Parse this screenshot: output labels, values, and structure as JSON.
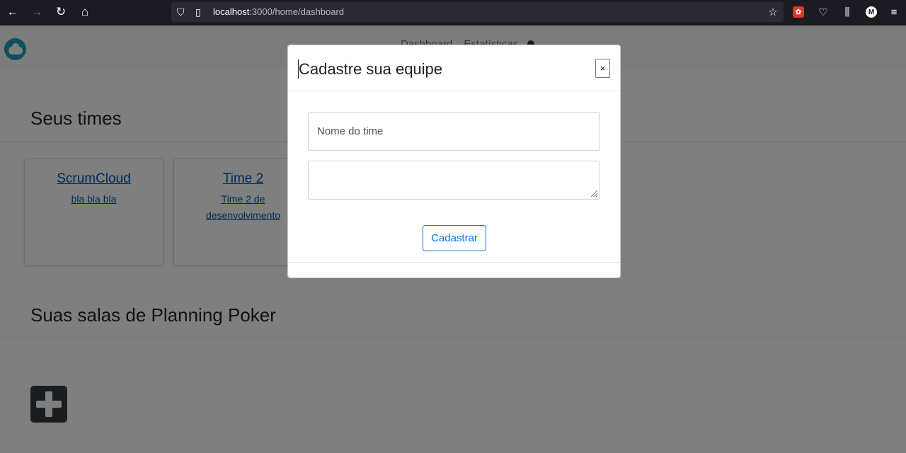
{
  "browser": {
    "url_host": "localhost",
    "url_rest": ":3000/home/dashboard",
    "account_initial": "M"
  },
  "nav": {
    "links": [
      "Dashboard",
      "Estatísticas"
    ]
  },
  "teams_section": {
    "title": "Seus times",
    "cards": [
      {
        "name": "ScrumCloud",
        "description": "bla bla bla"
      },
      {
        "name": "Time 2",
        "description": "Time 2 de desenvolvimento"
      }
    ]
  },
  "poker_section": {
    "title": "Suas salas de Planning Poker"
  },
  "modal": {
    "title": "Cadastre sua equipe",
    "close_label": "×",
    "name_placeholder": "Nome do time",
    "description_value": "",
    "submit_label": "Cadastrar"
  },
  "colors": {
    "primary": "#007bff",
    "logo": "#17a2b8",
    "backdrop": "rgba(0,0,0,0.5)"
  }
}
